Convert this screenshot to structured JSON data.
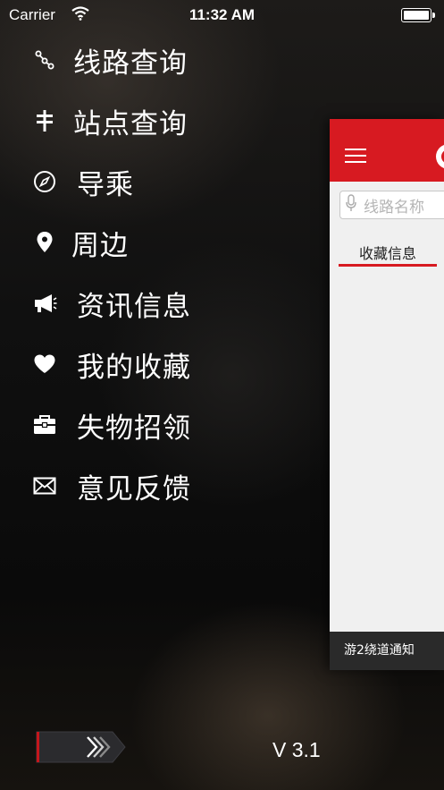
{
  "status_bar": {
    "carrier": "Carrier",
    "time": "11:32 AM"
  },
  "menu": {
    "items": [
      {
        "label": "线路查询",
        "icon": "route-icon"
      },
      {
        "label": "站点查询",
        "icon": "signpost-icon"
      },
      {
        "label": "导乘",
        "icon": "compass-icon"
      },
      {
        "label": "周边",
        "icon": "location-pin-icon"
      },
      {
        "label": "资讯信息",
        "icon": "megaphone-icon"
      },
      {
        "label": "我的收藏",
        "icon": "heart-icon"
      },
      {
        "label": "失物招领",
        "icon": "briefcase-icon"
      },
      {
        "label": "意见反馈",
        "icon": "envelope-icon"
      }
    ]
  },
  "panel": {
    "search_placeholder": "线路名称",
    "tab_label": "收藏信息",
    "notice": "游2绕道通知",
    "accent_color": "#d71a21"
  },
  "footer": {
    "version": "V 3.1"
  }
}
